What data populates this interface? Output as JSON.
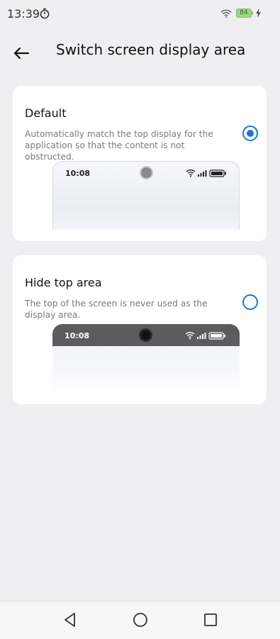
{
  "status_bar": {
    "time": "13:39",
    "battery_level": "84",
    "icons": [
      "timer-icon",
      "wifi-icon",
      "battery-icon",
      "charging-bolt-icon"
    ]
  },
  "header": {
    "title": "Switch screen display area",
    "back_icon": "back-arrow-icon"
  },
  "options": [
    {
      "title": "Default",
      "description": "Automatically match the top display for the application so that the content is not obstructed.",
      "selected": true,
      "preview": {
        "time": "10:08",
        "style": "light-top"
      }
    },
    {
      "title": "Hide top area",
      "description": "The top of the screen is never used as the display area.",
      "selected": false,
      "preview": {
        "time": "10:08",
        "style": "dark-top"
      }
    }
  ],
  "nav_bar": {
    "buttons": [
      "nav-back-icon",
      "nav-home-icon",
      "nav-recents-icon"
    ]
  },
  "colors": {
    "accent": "#1a73e8",
    "background": "#efeff1",
    "card": "#ffffff",
    "battery": "#9fd487"
  }
}
